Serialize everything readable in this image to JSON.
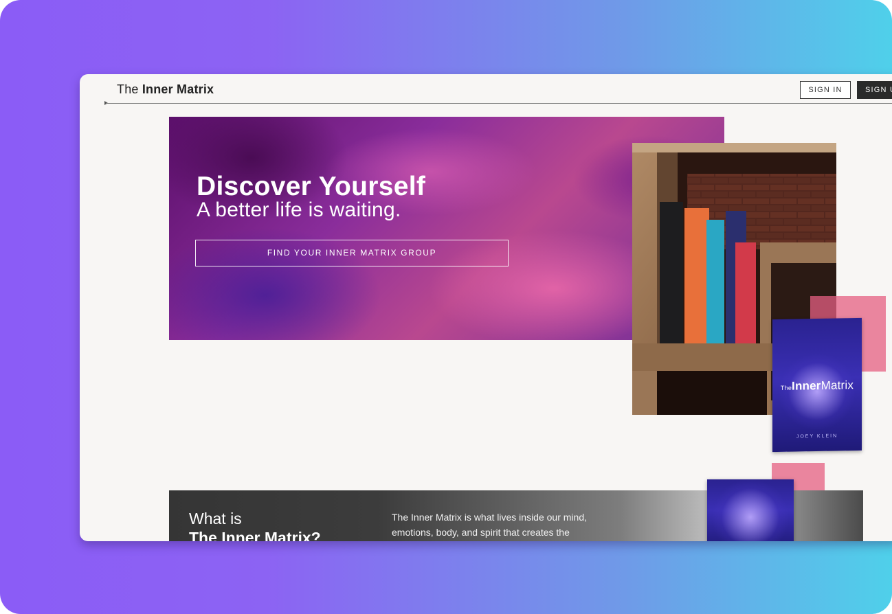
{
  "header": {
    "logo_prefix": "The",
    "logo_strong": "Inner Matrix",
    "sign_in": "SIGN IN",
    "sign_up": "SIGN UP"
  },
  "hero": {
    "title": "Discover Yourself",
    "subtitle": "A better life is waiting.",
    "cta": "FIND YOUR INNER MATRIX GROUP"
  },
  "book": {
    "title_prefix": "The",
    "title_strong": "Inner",
    "title_rest": "Matrix",
    "author": "JOEY KLEIN"
  },
  "about": {
    "heading_line1": "What is",
    "heading_line2": "The Inner Matrix?",
    "description": "The Inner Matrix is what lives inside our mind, emotions, body, and spirit that creates the"
  },
  "colors": {
    "background_start": "#8b5cf6",
    "background_end": "#4fd0ea",
    "accent_pink": "#e55f82",
    "dark": "#2a2a2a"
  }
}
